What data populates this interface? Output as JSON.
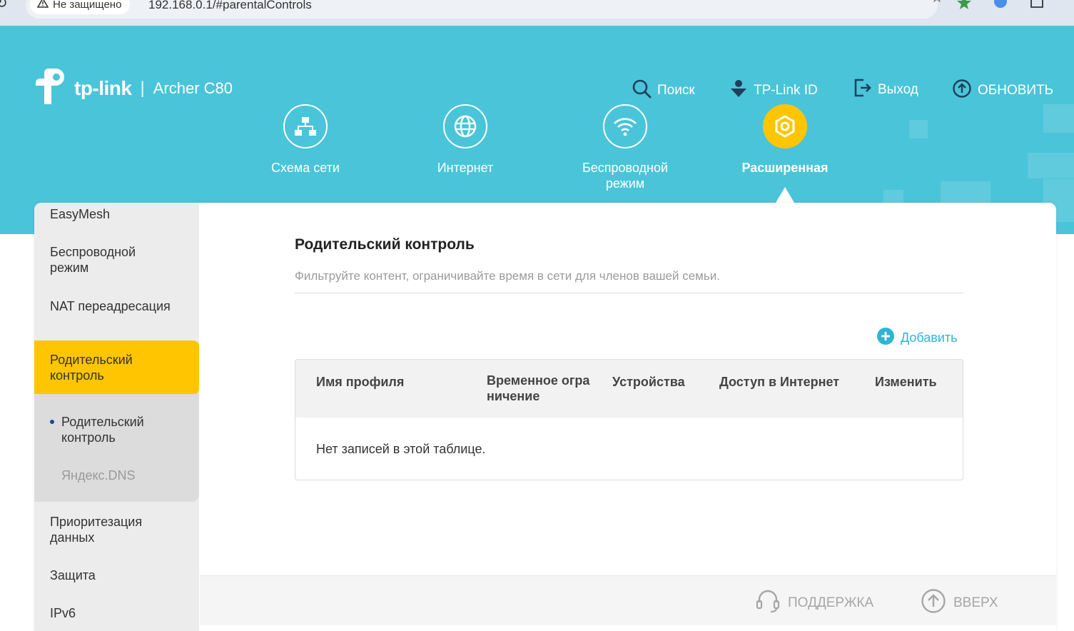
{
  "browser": {
    "security_label": "Не защищено",
    "url": "192.168.0.1/#parentalControls"
  },
  "header": {
    "brand": "tp-link",
    "separator": "|",
    "model": "Archer C80",
    "actions": {
      "search": "Поиск",
      "tplink_id": "TP-Link ID",
      "logout": "Выход",
      "update": "ОБНОВИТЬ"
    },
    "tabs": [
      {
        "label": "Схема сети",
        "icon": "network-map-icon"
      },
      {
        "label": "Интернет",
        "icon": "globe-icon"
      },
      {
        "label": "Беспроводной режим",
        "icon": "wifi-icon"
      },
      {
        "label": "Расширенная",
        "icon": "gear-icon",
        "active": true
      }
    ]
  },
  "sidebar": {
    "items": [
      "EasyMesh",
      "Беспроводной режим",
      "NAT переадресация",
      "Родительский контроль",
      "Приоритезация данных",
      "Защита",
      "IPv6"
    ],
    "submenu": [
      "Родительский контроль",
      "Яндекс.DNS"
    ]
  },
  "main": {
    "title": "Родительский контроль",
    "description": "Фильтруйте контент, ограничивайте время в сети для членов вашей семьи.",
    "add_label": "Добавить",
    "table": {
      "columns": [
        "Имя профиля",
        "Временное ограничение",
        "Устройства",
        "Доступ в Интернет",
        "Изменить"
      ],
      "col2_line1": "Временное огра",
      "col2_line2": "ничение",
      "empty": "Нет записей в этой таблице."
    }
  },
  "footer": {
    "support": "ПОДДЕРЖКА",
    "top": "ВВЕРХ"
  },
  "colors": {
    "header": "#4ac4d9",
    "accent": "#ffc500",
    "link": "#2db5d3"
  }
}
